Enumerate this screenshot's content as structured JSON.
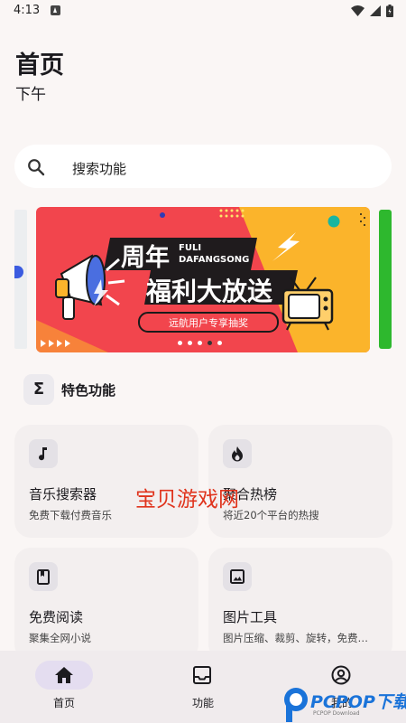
{
  "status_bar": {
    "time": "4:13"
  },
  "header": {
    "title": "首页",
    "subtitle": "下午"
  },
  "search": {
    "placeholder": "搜索功能"
  },
  "banner": {
    "title_line1": "周年",
    "title_line2": "福利大放送",
    "tag_line1": "FULI",
    "tag_line2": "DAFANGSONG",
    "button": "远航用户专享抽奖",
    "page_count": 5,
    "active_page": 3
  },
  "section": {
    "icon": "Σ",
    "title": "特色功能"
  },
  "cards": [
    {
      "title": "音乐搜索器",
      "desc": "免费下载付费音乐",
      "icon": "music-note-icon"
    },
    {
      "title": "聚合热榜",
      "desc": "将近20个平台的热搜",
      "icon": "flame-icon"
    },
    {
      "title": "免费阅读",
      "desc": "聚集全网小说",
      "icon": "book-icon"
    },
    {
      "title": "图片工具",
      "desc": "图片压缩、裁剪、旋转，免费…",
      "icon": "image-icon"
    }
  ],
  "watermark": "宝贝游戏网",
  "nav": {
    "items": [
      {
        "label": "首页",
        "icon": "home-icon",
        "active": true
      },
      {
        "label": "功能",
        "icon": "inbox-icon",
        "active": false
      },
      {
        "label": "我的",
        "icon": "account-icon",
        "active": false
      }
    ]
  },
  "pc_logo": {
    "text": "PCPOP下载",
    "sub": "PCPOP Download"
  },
  "colors": {
    "background": "#faf6f5",
    "banner_red": "#f2454d",
    "banner_yellow": "#fbb42b",
    "accent_green": "#2eb82e",
    "nav_active": "#e4ddf0"
  }
}
